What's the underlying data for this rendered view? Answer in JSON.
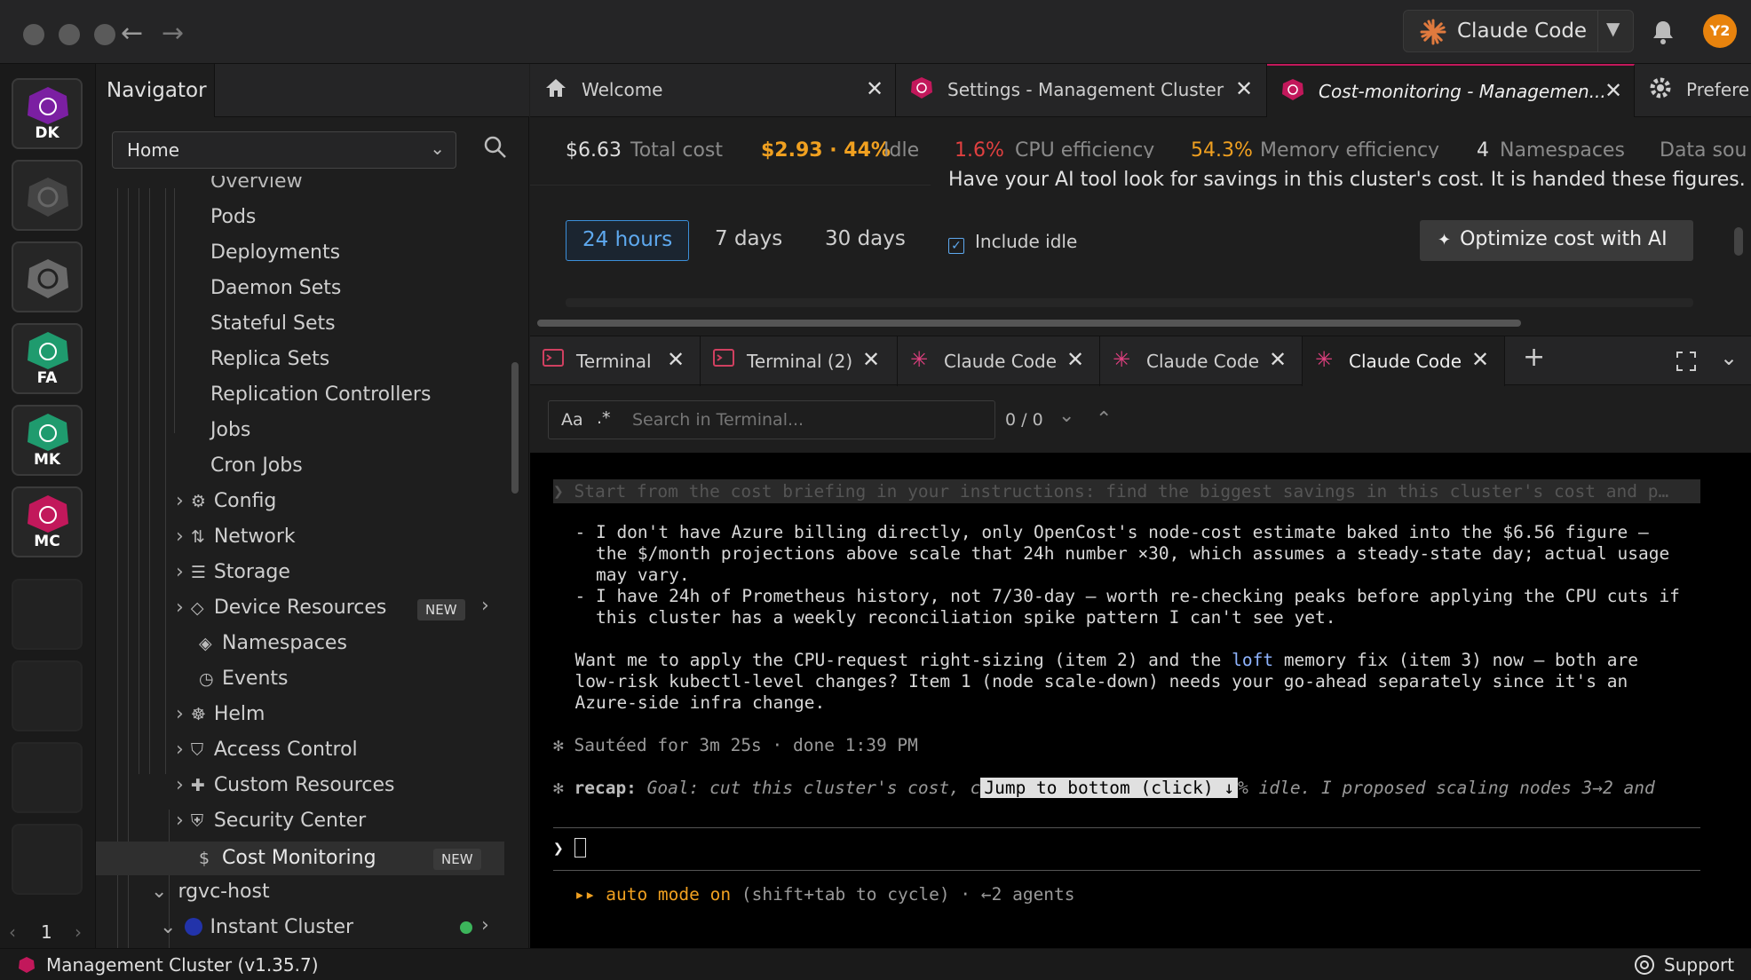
{
  "window": {
    "back_label": "←",
    "forward_label": "→"
  },
  "topbar": {
    "app_label": "Claude Code",
    "avatar_initials": "Y2"
  },
  "hotbar": {
    "items": [
      {
        "label": "DK",
        "color": "#7b1fa2"
      },
      {
        "label": "",
        "color": "#555555"
      },
      {
        "label": "",
        "color": "#888888"
      },
      {
        "label": "FA",
        "color": "#1f9b6e"
      },
      {
        "label": "MK",
        "color": "#1f9b6e"
      },
      {
        "label": "MC",
        "color": "#c2185b"
      }
    ],
    "page": "1",
    "prev": "‹",
    "next": "›"
  },
  "navigator": {
    "title": "Navigator",
    "select_value": "Home",
    "overview_partial": "Overview",
    "workloads": [
      "Pods",
      "Deployments",
      "Daemon Sets",
      "Stateful Sets",
      "Replica Sets",
      "Replication Controllers",
      "Jobs",
      "Cron Jobs"
    ],
    "sections": [
      {
        "label": "Config",
        "icon": "gear-cluster-icon"
      },
      {
        "label": "Network",
        "icon": "arrows-icon"
      },
      {
        "label": "Storage",
        "icon": "database-icon"
      },
      {
        "label": "Device Resources",
        "icon": "chip-icon",
        "badge": "NEW"
      },
      {
        "label": "Namespaces",
        "icon": "layers-icon"
      },
      {
        "label": "Events",
        "icon": "clock-icon"
      },
      {
        "label": "Helm",
        "icon": "helm-icon"
      },
      {
        "label": "Access Control",
        "icon": "shield-icon"
      },
      {
        "label": "Custom Resources",
        "icon": "puzzle-icon"
      },
      {
        "label": "Security Center",
        "icon": "shield-search-icon"
      },
      {
        "label": "Cost Monitoring",
        "icon": "dollar-icon",
        "badge": "NEW"
      }
    ],
    "host": "rgvc-host",
    "instant_cluster": "Instant Cluster"
  },
  "tabs": [
    {
      "label": "Welcome"
    },
    {
      "label": "Settings - Management Cluster"
    },
    {
      "label": "Cost-monitoring - Managemen..."
    },
    {
      "label": "Prefere"
    }
  ],
  "stats": {
    "total_cost": "$6.63",
    "total_cost_label": "Total cost",
    "idle_value": "$2.93 · 44%",
    "idle_label": "Idle",
    "cpu_value": "1.6%",
    "cpu_label": "CPU efficiency",
    "mem_value": "54.3%",
    "mem_label": "Memory efficiency",
    "ns_value": "4",
    "ns_label": "Namespaces",
    "data_label": "Data sou"
  },
  "tooltip": "Have your AI tool look for savings in this cluster's cost. It is handed these figures.",
  "range": {
    "options": [
      "24 hours",
      "7 days",
      "30 days"
    ],
    "selected": "24 hours",
    "include_idle": "Include idle",
    "include_idle_checked": true
  },
  "optimize_label": "Optimize cost with AI",
  "dock": {
    "tabs": [
      {
        "label": "Terminal",
        "type": "terminal"
      },
      {
        "label": "Terminal (2)",
        "type": "terminal"
      },
      {
        "label": "Claude Code",
        "type": "claude"
      },
      {
        "label": "Claude Code",
        "type": "claude"
      },
      {
        "label": "Claude Code",
        "type": "claude"
      }
    ],
    "add": "+"
  },
  "terminal_search": {
    "case_label": "Aa",
    "regex_label": ".*",
    "placeholder": "Search in Terminal...",
    "count": "0 / 0"
  },
  "terminal": {
    "prompt_prev": "❯ Start from the cost briefing in your instructions: find the biggest savings in this cluster's cost and p…",
    "b1a": "  - I don't have Azure billing directly, only OpenCost's node-cost estimate baked into the $6.56 figure —",
    "b1b": "    the $/month projections above scale that 24h number ×30, which assumes a steady-state day; actual usage",
    "b1c": "    may vary.",
    "b2a": "  - I have 24h of Prometheus history, not 7/30-day — worth re-checking peaks before applying the CPU cuts if",
    "b2b": "    this cluster has a weekly reconciliation spike pattern I can't see yet.",
    "w1a": "  Want me to apply the CPU-request right-sizing (item 2) and the ",
    "w1loft": "loft",
    "w1b": " memory fix (item 3) now — both are",
    "w2": "  low-risk kubectl-level changes? Item 1 (node scale-down) needs your go-ahead separately since it's an",
    "w3": "  Azure-side infra change.",
    "sauteed": "✻ Sautéed for 3m 25s · done 1:39 PM",
    "recap_star": "✻ ",
    "recap_label": "recap:",
    "recap_text": " Goal: cut this cluster's cost, c",
    "recap_jump": "Jump to bottom (click) ↓",
    "recap_tail": "% idle. I proposed scaling nodes 3→2 and",
    "prompt": "❯",
    "auto_mode": "▸▸ auto mode on",
    "auto_hint": " (shift+tab to cycle) · ←2 agents"
  },
  "statusbar": {
    "cluster": "Management Cluster (v1.35.7)",
    "support": "Support"
  }
}
